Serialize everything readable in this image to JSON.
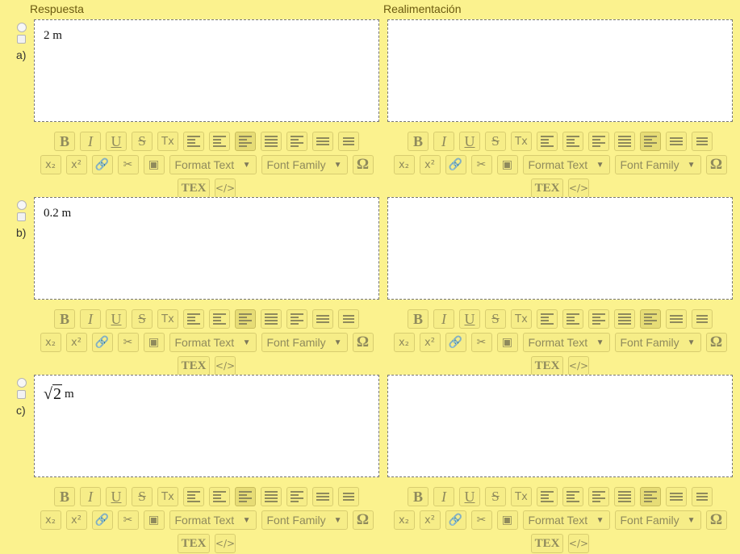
{
  "headers": {
    "answer": "Respuesta",
    "feedback": "Realimentación"
  },
  "options": [
    {
      "letter": "a)",
      "answer": "2 m",
      "math": false
    },
    {
      "letter": "b)",
      "answer": "0.2 m",
      "math": false
    },
    {
      "letter": "c)",
      "answer": "m",
      "math": true,
      "radicand": "2"
    }
  ],
  "toolbar": {
    "format_text": "Format Text",
    "font_family": "Font Family",
    "bold": "B",
    "italic": "I",
    "underline": "U",
    "strike": "S",
    "clear_format": "Tx",
    "subscript": "x₂",
    "superscript": "x²",
    "special_char": "Ω",
    "tex": "TEX",
    "source": "</>"
  },
  "icons": [
    "indent-icon",
    "outdent-icon",
    "align-left-icon",
    "align-center-icon",
    "align-right-icon",
    "bullet-list-icon",
    "numbered-list-icon",
    "link-icon",
    "unlink-icon",
    "image-icon"
  ],
  "colors": {
    "background": "#fbf28e",
    "toolbar_button": "#f6ed88",
    "editor": "#ffffff"
  }
}
